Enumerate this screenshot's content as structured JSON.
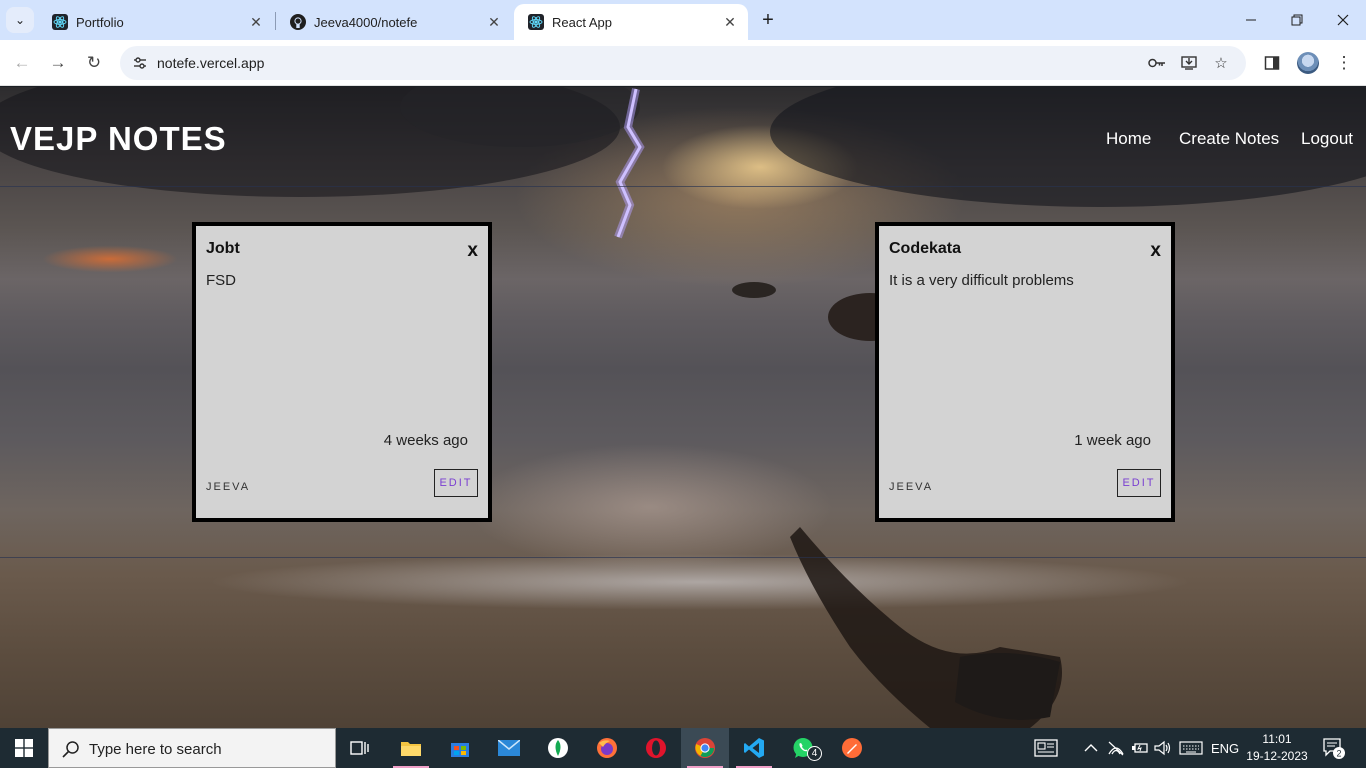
{
  "browser": {
    "tabs": [
      {
        "title": "Portfolio",
        "favicon": "react-icon",
        "active": false
      },
      {
        "title": "Jeeva4000/notefe",
        "favicon": "github-icon",
        "active": false
      },
      {
        "title": "React App",
        "favicon": "react-icon",
        "active": true
      }
    ],
    "url": "notefe.vercel.app"
  },
  "app": {
    "brand": "VEJP NOTES",
    "nav": [
      "Home",
      "Create Notes",
      "Logout"
    ],
    "notes": [
      {
        "title": "Jobt",
        "body": "FSD",
        "time": "4 weeks ago",
        "author": "JEEVA",
        "edit_label": "EDIT",
        "delete_label": "x"
      },
      {
        "title": "Codekata",
        "body": "It is a very difficult problems",
        "time": "1 week ago",
        "author": "JEEVA",
        "edit_label": "EDIT",
        "delete_label": "x"
      }
    ]
  },
  "taskbar": {
    "search_placeholder": "Type here to search",
    "whatsapp_badge": "4",
    "language": "ENG",
    "time": "11:01",
    "date": "19-12-2023",
    "notification_count": "2"
  },
  "colors": {
    "tabbar": "#d3e3fd",
    "card_bg": "#d3d3d3",
    "edit_text": "#7a3fd1",
    "taskbar": "#1e2b33"
  }
}
